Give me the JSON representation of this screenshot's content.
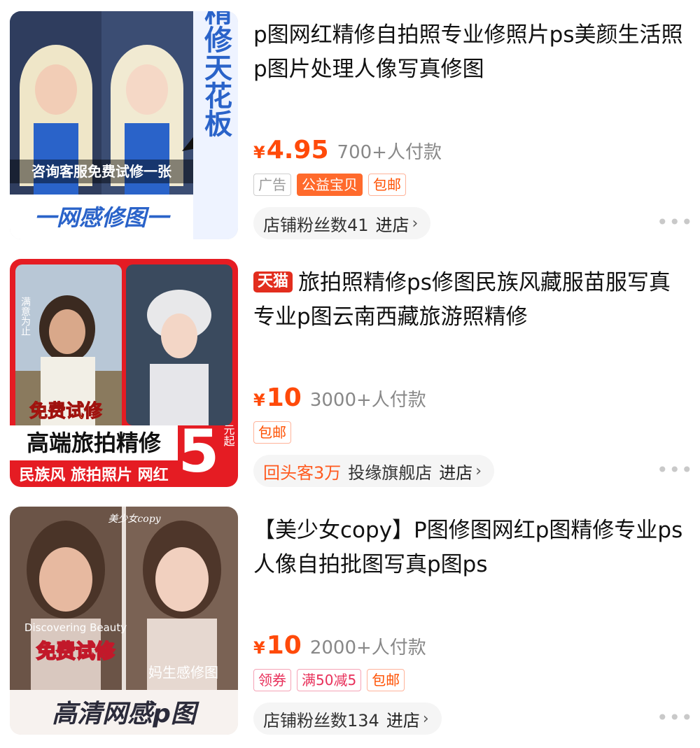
{
  "items": [
    {
      "thumb_lines": [
        "咨询客服免费试修一张",
        "一网感修图一",
        "人像精修天花板"
      ],
      "tmall_badge": "",
      "title": "p图网红精修自拍照专业修照片ps美颜生活照p图片处理人像写真修图",
      "currency": "¥",
      "price": "4.95",
      "sold": "700+人付款",
      "tags": [
        "广告",
        "公益宝贝",
        "包邮"
      ],
      "store_highlight": "",
      "store_text": "店铺粉丝数41",
      "enter_text": "进店",
      "chev": "›",
      "more": "•••"
    },
    {
      "thumb_lines": [
        "满意为止",
        "免费试修",
        "高端旅拍精修",
        "民族风 旅拍照片 网红",
        "5",
        "元起"
      ],
      "tmall_badge": "天猫",
      "title": "旅拍照精修ps修图民族风藏服苗服写真专业p图云南西藏旅游照精修",
      "currency": "¥",
      "price": "10",
      "sold": "3000+人付款",
      "tags": [
        "包邮"
      ],
      "store_highlight": "回头客3万",
      "store_text": "投缘旗舰店",
      "enter_text": "进店",
      "chev": "›",
      "more": "•••"
    },
    {
      "thumb_lines": [
        "美少女copy",
        "Discovering Beauty",
        "免费试修",
        "妈生感修图",
        "高清网感p图"
      ],
      "tmall_badge": "",
      "title": "【美少女copy】P图修图网红p图精修专业ps人像自拍批图写真p图ps",
      "currency": "¥",
      "price": "10",
      "sold": "2000+人付款",
      "tags": [
        "领券",
        "满50减5",
        "包邮"
      ],
      "store_highlight": "",
      "store_text": "店铺粉丝数134",
      "enter_text": "进店",
      "chev": "›",
      "more": "•••"
    }
  ]
}
